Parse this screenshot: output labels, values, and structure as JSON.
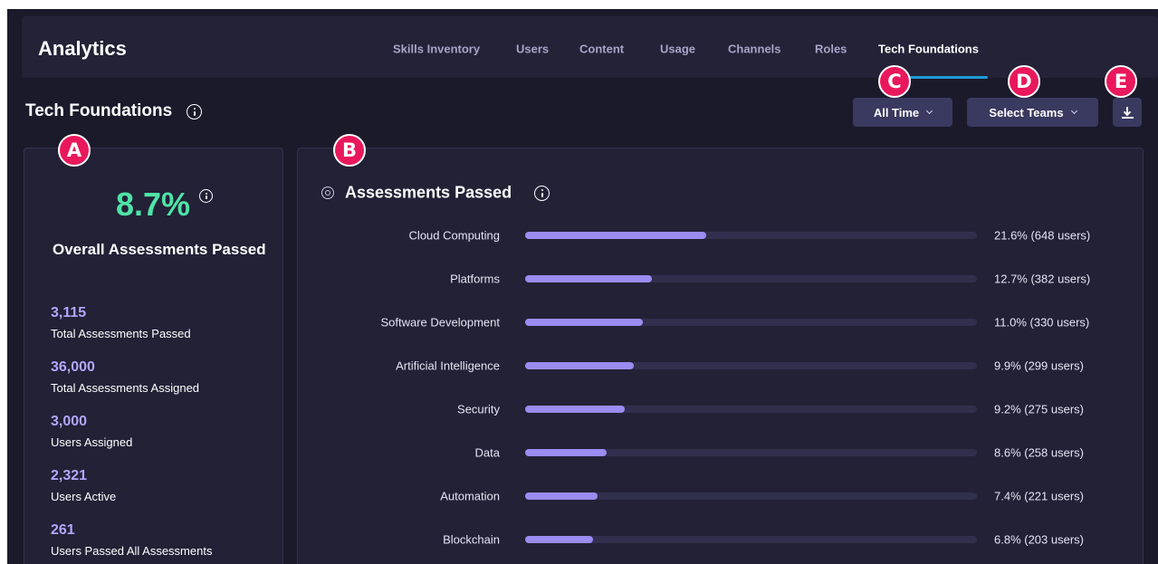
{
  "header": {
    "app_title": "Analytics",
    "tabs": [
      {
        "label": "Skills Inventory",
        "active": false
      },
      {
        "label": "Users",
        "active": false
      },
      {
        "label": "Content",
        "active": false
      },
      {
        "label": "Usage",
        "active": false
      },
      {
        "label": "Channels",
        "active": false
      },
      {
        "label": "Roles",
        "active": false
      },
      {
        "label": "Tech Foundations",
        "active": true
      }
    ]
  },
  "page": {
    "title": "Tech Foundations"
  },
  "controls": {
    "time_filter": "All Time",
    "team_filter": "Select Teams",
    "download_icon": "download-icon"
  },
  "markers": [
    "A",
    "B",
    "C",
    "D",
    "E"
  ],
  "summary": {
    "overall_pct": "8.7%",
    "overall_label": "Overall Assessments Passed",
    "stats": [
      {
        "value": "3,115",
        "label": "Total Assessments Passed"
      },
      {
        "value": "36,000",
        "label": "Total Assessments Assigned"
      },
      {
        "value": "3,000",
        "label": "Users Assigned"
      },
      {
        "value": "2,321",
        "label": "Users Active"
      },
      {
        "value": "261",
        "label": "Users Passed All Assessments"
      }
    ]
  },
  "assessments": {
    "title": "Assessments Passed",
    "icon": "target-icon",
    "bar_color": "#9a8cf0",
    "rows": [
      {
        "category": "Cloud Computing",
        "value_text": "21.6% (648 users)",
        "fill": 0.4
      },
      {
        "category": "Platforms",
        "value_text": "12.7% (382 users)",
        "fill": 0.28
      },
      {
        "category": "Software Development",
        "value_text": "11.0% (330 users)",
        "fill": 0.26
      },
      {
        "category": "Artificial Intelligence",
        "value_text": "9.9% (299 users)",
        "fill": 0.24
      },
      {
        "category": "Security",
        "value_text": "9.2% (275 users)",
        "fill": 0.22
      },
      {
        "category": "Data",
        "value_text": "8.6% (258 users)",
        "fill": 0.18
      },
      {
        "category": "Automation",
        "value_text": "7.4% (221 users)",
        "fill": 0.16
      },
      {
        "category": "Blockchain",
        "value_text": "6.8% (203 users)",
        "fill": 0.15
      }
    ]
  },
  "colors": {
    "accent_green": "#4fe3a7",
    "accent_purple": "#b3a6ff",
    "marker": "#e9185c",
    "tab_underline": "#1c9ad6"
  }
}
